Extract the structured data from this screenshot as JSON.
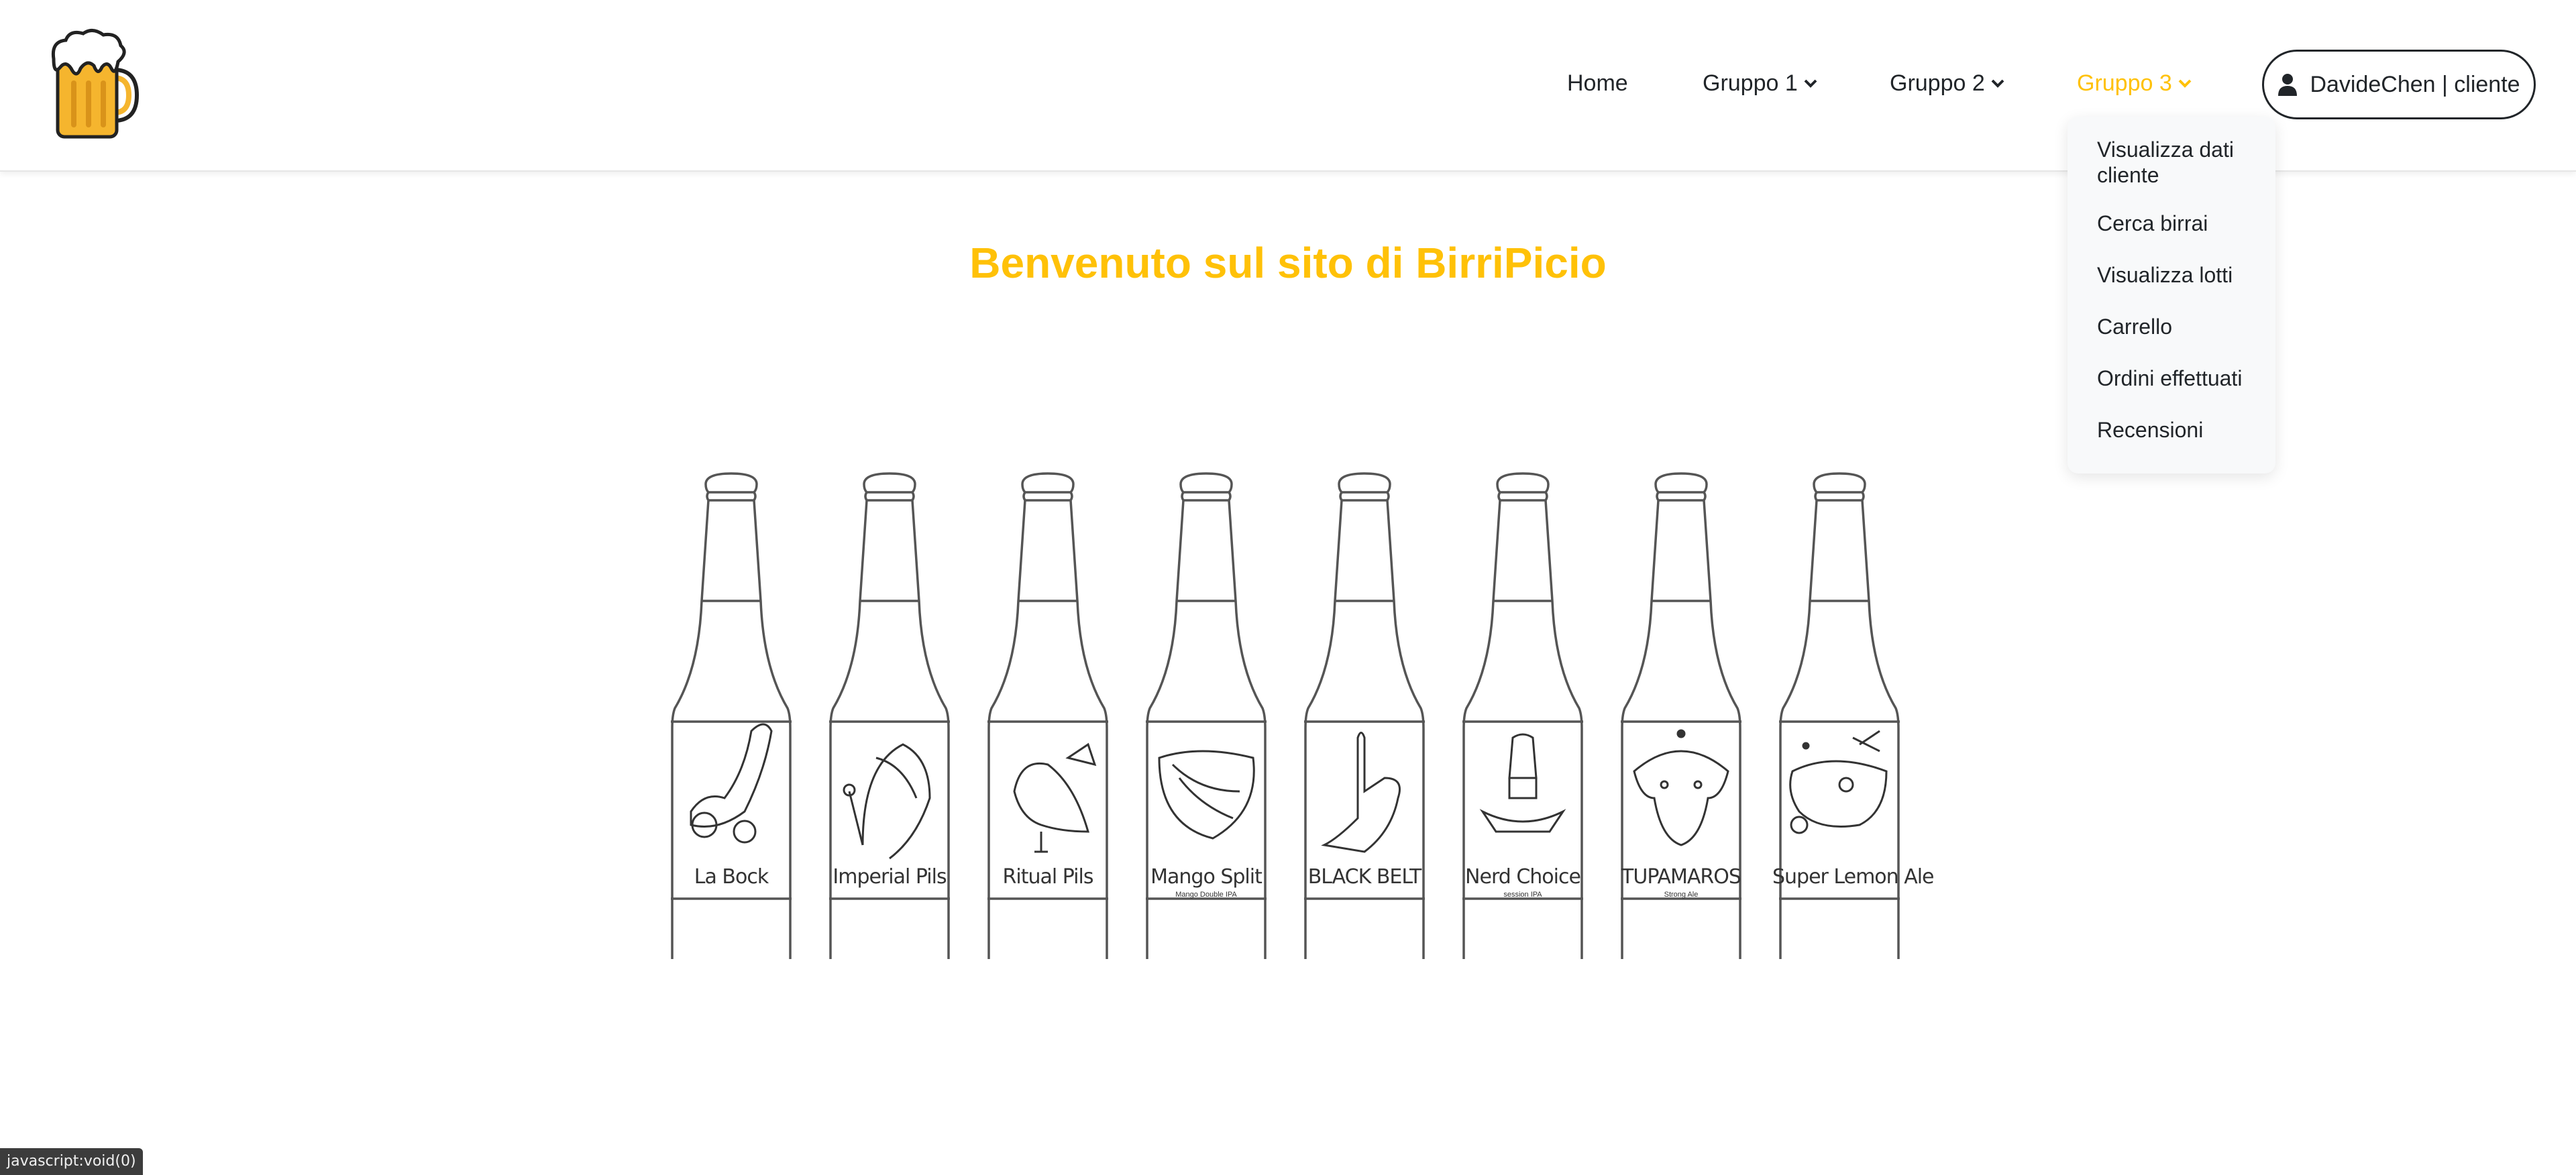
{
  "header": {
    "logo_alt": "beer-mug-logo",
    "nav": {
      "home": "Home",
      "gruppo1": "Gruppo 1",
      "gruppo2": "Gruppo 2",
      "gruppo3": "Gruppo 3"
    },
    "user_button": "DavideChen | cliente"
  },
  "dropdown": {
    "items": [
      "Visualizza dati cliente",
      "Cerca birrai",
      "Visualizza lotti",
      "Carrello",
      "Ordini effettuati",
      "Recensioni"
    ]
  },
  "main": {
    "title": "Benvenuto sul sito di BirriPicio",
    "bottles": [
      {
        "label": "La Bock",
        "sub": ""
      },
      {
        "label": "Imperial Pils",
        "sub": ""
      },
      {
        "label": "Ritual Pils",
        "sub": ""
      },
      {
        "label": "Mango Split",
        "sub": "Mango Double IPA"
      },
      {
        "label": "BLACK BELT",
        "sub": ""
      },
      {
        "label": "Nerd Choice",
        "sub": "session IPA"
      },
      {
        "label": "TUPAMAROS",
        "sub": "Strong Ale"
      },
      {
        "label": "Super Lemon Ale",
        "sub": ""
      }
    ]
  },
  "statusbar": "javascript:void(0)",
  "colors": {
    "accent": "#ffc107",
    "text": "#212529",
    "dropdown_bg": "#f8f9fa"
  }
}
